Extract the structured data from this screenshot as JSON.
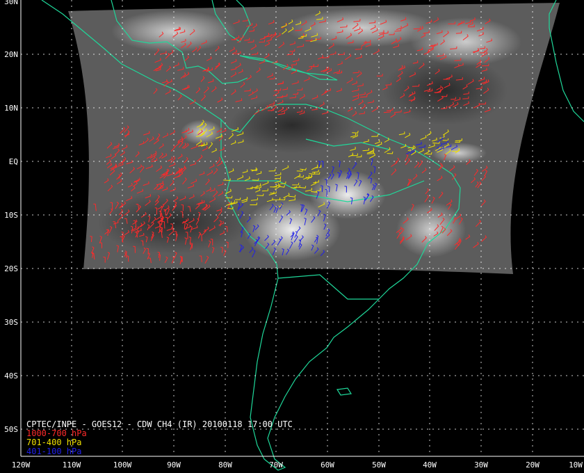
{
  "map": {
    "caption": "CPTEC/INPE - GOES12 - CDW CH4 (IR) 20100118 17:00 UTC",
    "longitude_labels": [
      "120W",
      "110W",
      "100W",
      "90W",
      "80W",
      "70W",
      "60W",
      "50W",
      "40W",
      "30W",
      "20W",
      "10W"
    ],
    "latitude_labels": [
      "30N",
      "20N",
      "10N",
      "EQ",
      "10S",
      "20S",
      "30S",
      "40S",
      "50S"
    ],
    "legend": [
      {
        "label": "1000-700 hPa",
        "color": "#ff2a2a"
      },
      {
        "label": "701-400 hPa",
        "color": "#f0e000"
      },
      {
        "label": "401-100 hPa",
        "color": "#2020e8"
      }
    ],
    "colors": {
      "background": "#000000",
      "coastline": "#1fd89a",
      "grid": "#ffffff",
      "satellite_image": "#5a5a5a"
    }
  }
}
